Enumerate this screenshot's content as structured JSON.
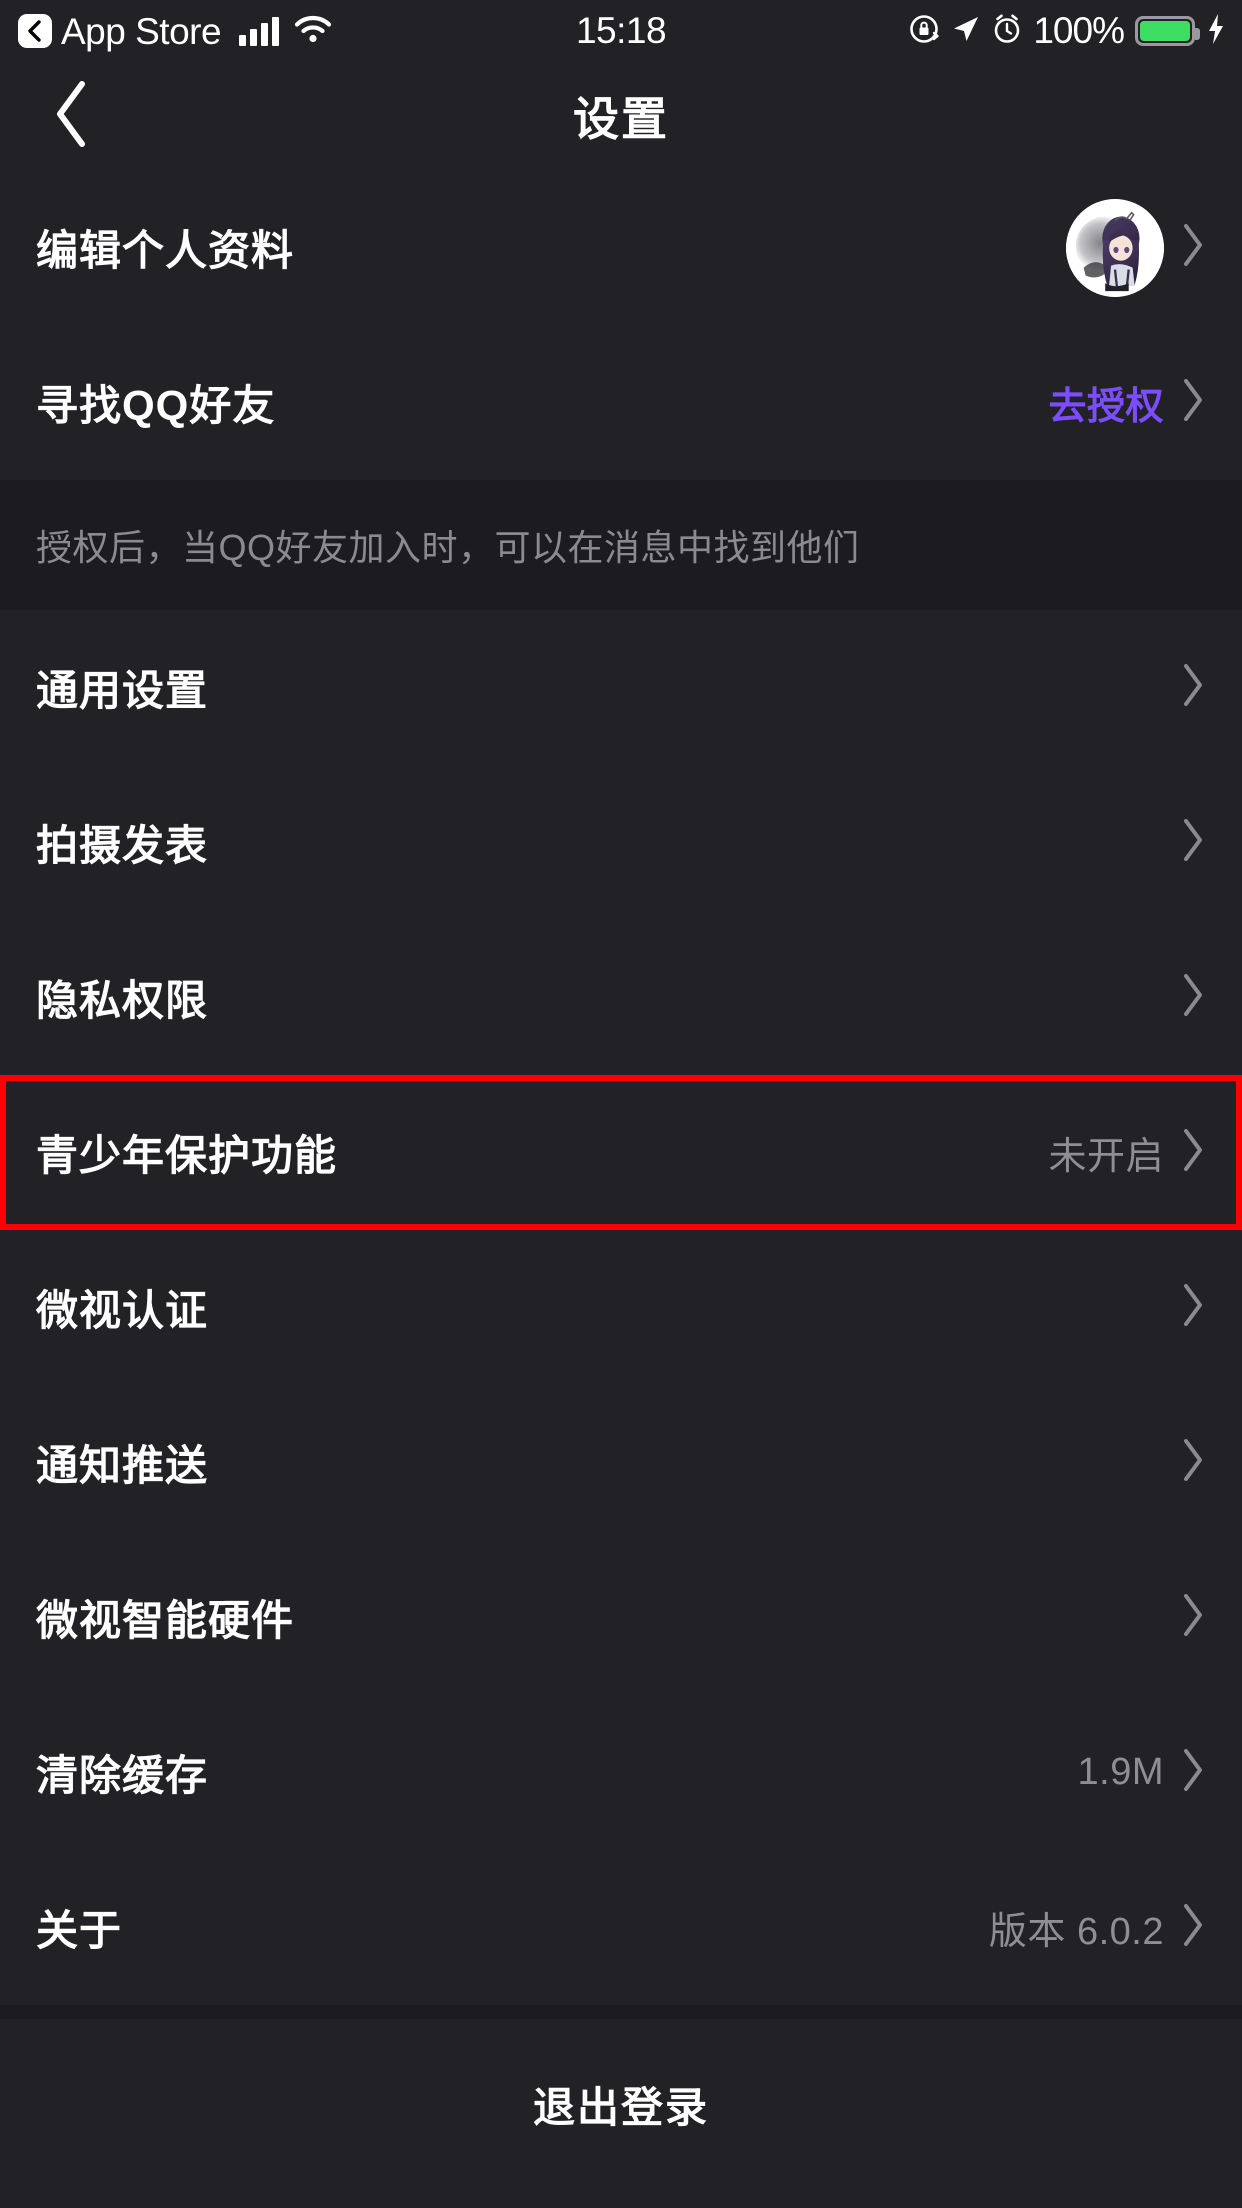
{
  "status_bar": {
    "back_app": "App Store",
    "time": "15:18",
    "battery_percent": "100%",
    "icons": [
      "back-chevron-badge-icon",
      "cellular-signal-icon",
      "wifi-icon",
      "rotation-lock-icon",
      "location-arrow-icon",
      "alarm-clock-icon",
      "battery-icon",
      "charging-bolt-icon"
    ],
    "colors": {
      "battery_fill": "#3ddc62"
    }
  },
  "nav": {
    "title": "设置",
    "back_icon": "chevron-left-icon"
  },
  "list": {
    "rows": [
      {
        "label": "编辑个人资料",
        "value": "",
        "accent": false,
        "has_avatar": true
      },
      {
        "label": "寻找QQ好友",
        "value": "去授权",
        "accent": true,
        "has_avatar": false
      }
    ],
    "note": "授权后，当QQ好友加入时，可以在消息中找到他们",
    "rows2": [
      {
        "label": "通用设置",
        "value": "",
        "accent": false,
        "highlight": false
      },
      {
        "label": "拍摄发表",
        "value": "",
        "accent": false,
        "highlight": false
      },
      {
        "label": "隐私权限",
        "value": "",
        "accent": false,
        "highlight": false
      },
      {
        "label": "青少年保护功能",
        "value": "未开启",
        "accent": false,
        "highlight": true
      },
      {
        "label": "微视认证",
        "value": "",
        "accent": false,
        "highlight": false
      },
      {
        "label": "通知推送",
        "value": "",
        "accent": false,
        "highlight": false
      },
      {
        "label": "微视智能硬件",
        "value": "",
        "accent": false,
        "highlight": false
      },
      {
        "label": "清除缓存",
        "value": "1.9M",
        "accent": false,
        "highlight": false
      },
      {
        "label": "关于",
        "value": "版本 6.0.2",
        "accent": false,
        "highlight": false
      }
    ]
  },
  "footer": {
    "logout_label": "退出登录"
  },
  "colors": {
    "background": "#222226",
    "separator": "#1b1b20",
    "accent_purple": "#7c4dff",
    "value_gray": "#8e8e93",
    "highlight_red": "#ff0000"
  }
}
